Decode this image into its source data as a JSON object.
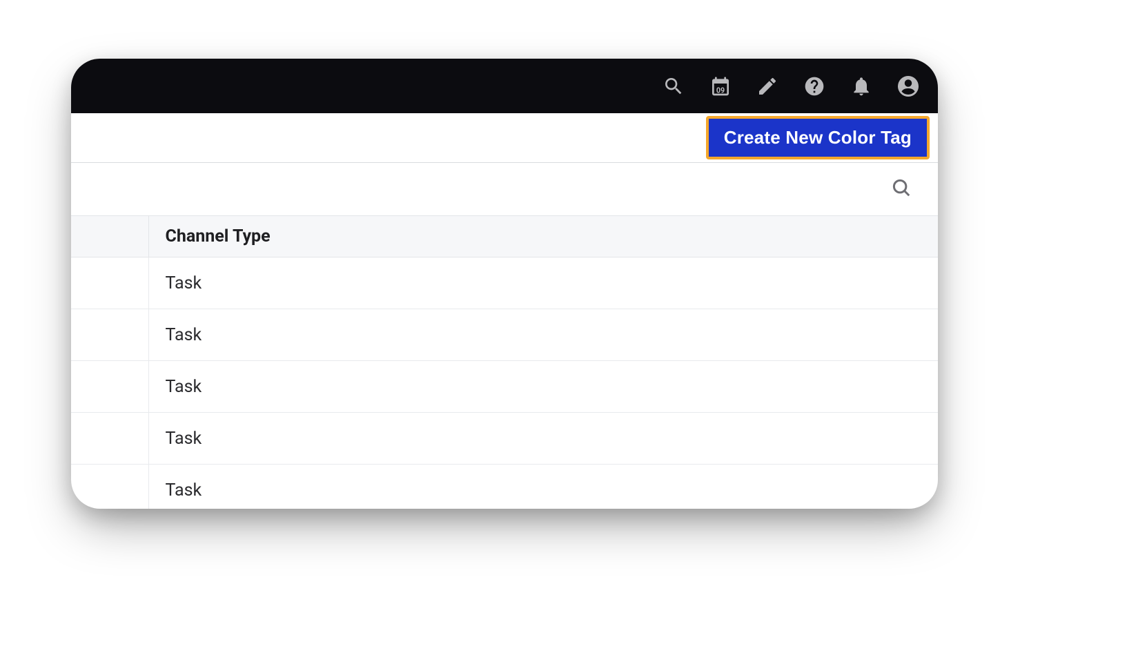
{
  "header": {
    "calendar_day": "09"
  },
  "toolbar": {
    "create_label": "Create New Color Tag"
  },
  "table": {
    "header": "Channel Type",
    "rows": [
      {
        "value": "Task"
      },
      {
        "value": "Task"
      },
      {
        "value": "Task"
      },
      {
        "value": "Task"
      },
      {
        "value": "Task"
      }
    ]
  }
}
